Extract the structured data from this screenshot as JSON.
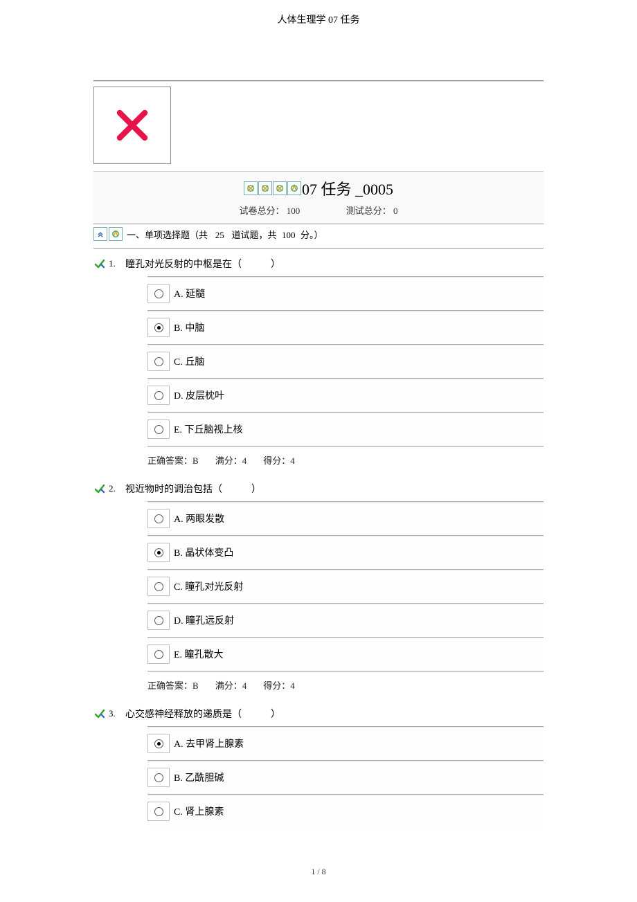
{
  "page_title": "人体生理学 07 任务",
  "footer": "1 / 8",
  "quiz": {
    "title": "07 任务 _0005",
    "paper_total_label": "试卷总分：",
    "paper_total": "100",
    "test_total_label": "测试总分：",
    "test_total": "0"
  },
  "section": {
    "prefix": "一、单项选择题（共",
    "count": "25",
    "mid": "道试题，共",
    "score": "100",
    "suffix": "分。）"
  },
  "questions": [
    {
      "num": "1.",
      "text": "瞳孔对光反射的中枢是在（　　　）",
      "options": [
        {
          "label": "A.  延髓",
          "selected": false
        },
        {
          "label": "B.  中脑",
          "selected": true
        },
        {
          "label": "C.  丘脑",
          "selected": false
        },
        {
          "label": "D.  皮层枕叶",
          "selected": false
        },
        {
          "label": "E.  下丘脑视上核",
          "selected": false
        }
      ],
      "answer": {
        "correct_label": "正确答案：",
        "correct": "B",
        "full_label": "满分：",
        "full": "4",
        "got_label": "得分：",
        "got": "4"
      }
    },
    {
      "num": "2.",
      "text": "视近物时的调治包括（　　　）",
      "options": [
        {
          "label": "A.  两眼发散",
          "selected": false
        },
        {
          "label": "B.  晶状体变凸",
          "selected": true
        },
        {
          "label": "C.  瞳孔对光反射",
          "selected": false
        },
        {
          "label": "D.  瞳孔远反射",
          "selected": false
        },
        {
          "label": "E.  瞳孔散大",
          "selected": false
        }
      ],
      "answer": {
        "correct_label": "正确答案：",
        "correct": "B",
        "full_label": "满分：",
        "full": "4",
        "got_label": "得分：",
        "got": "4"
      }
    },
    {
      "num": "3.",
      "text": "心交感神经释放的递质是（　　　）",
      "options": [
        {
          "label": "A.  去甲肾上腺素",
          "selected": true
        },
        {
          "label": "B.  乙酰胆碱",
          "selected": false
        },
        {
          "label": "C.  肾上腺素",
          "selected": false
        }
      ],
      "answer": null
    }
  ]
}
